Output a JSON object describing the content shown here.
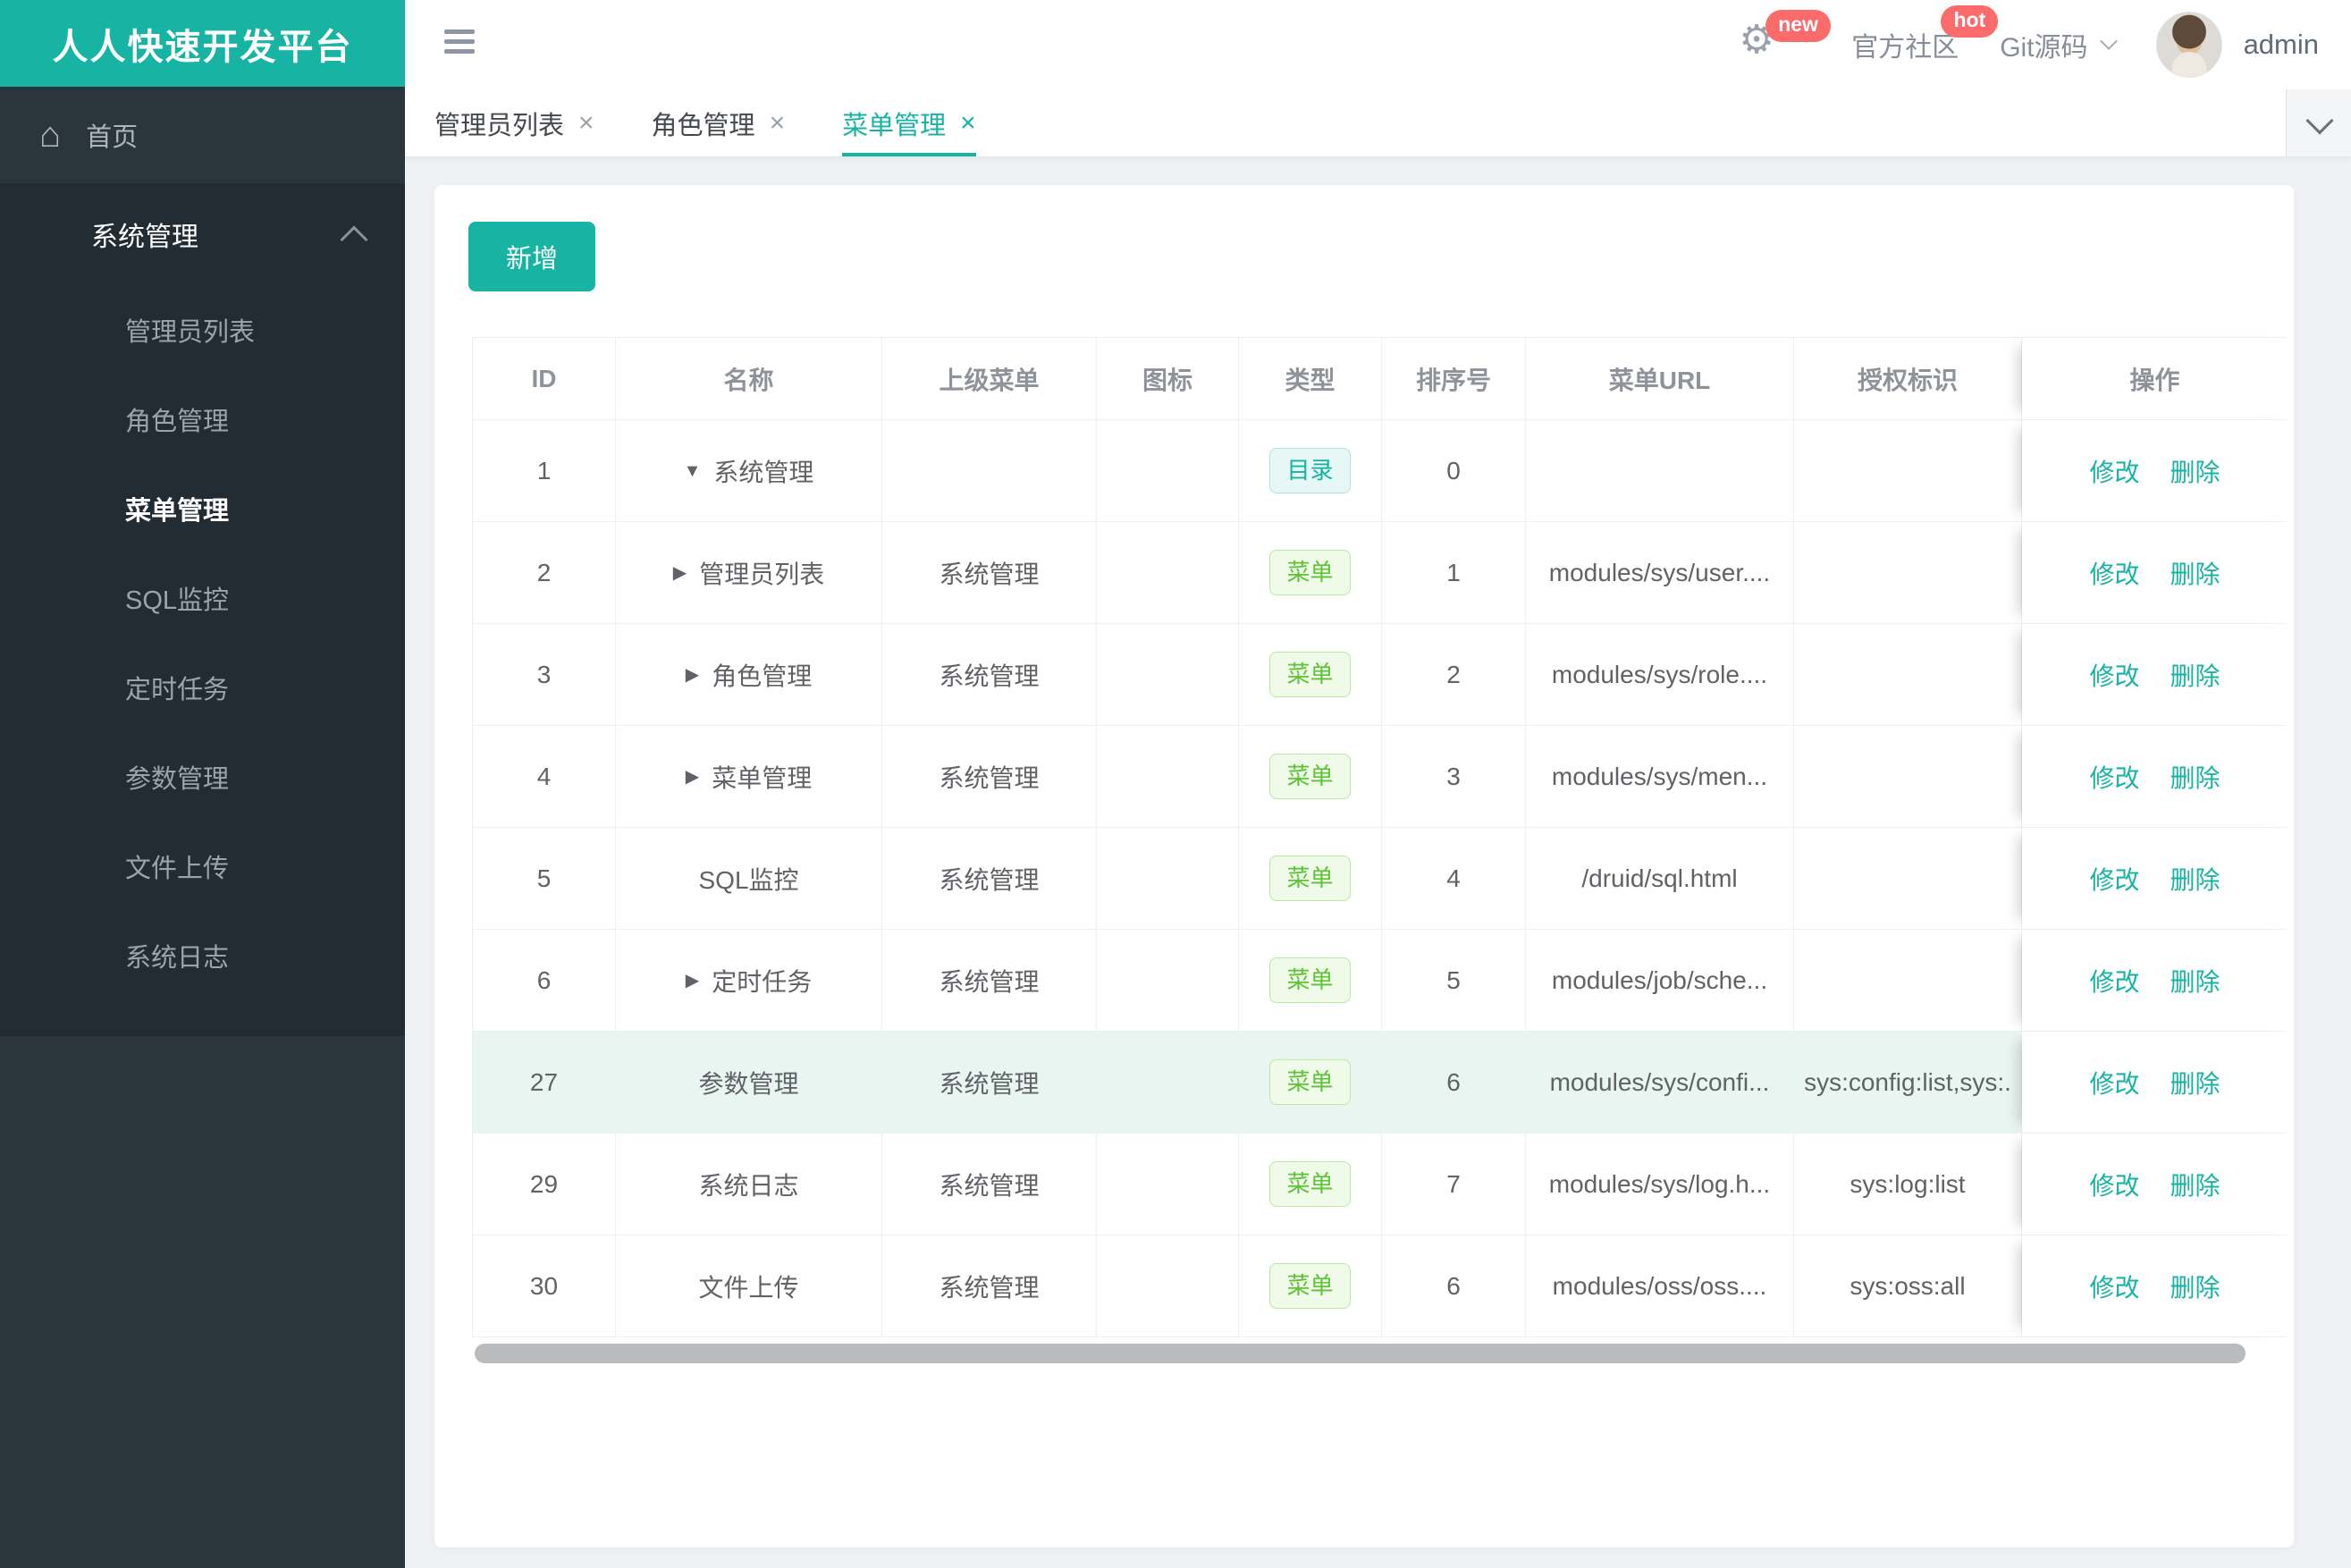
{
  "brand": {
    "title": "人人快速开发平台"
  },
  "header": {
    "gear_badge": "new",
    "community_label": "官方社区",
    "community_badge": "hot",
    "git_label": "Git源码",
    "username": "admin"
  },
  "tabbar": {
    "close_glyph": "×",
    "tabs": [
      {
        "label": "管理员列表",
        "active": false
      },
      {
        "label": "角色管理",
        "active": false
      },
      {
        "label": "菜单管理",
        "active": true
      }
    ]
  },
  "sidebar": {
    "home_label": "首页",
    "group_label": "系统管理",
    "items": [
      "管理员列表",
      "角色管理",
      "菜单管理",
      "SQL监控",
      "定时任务",
      "参数管理",
      "文件上传",
      "系统日志"
    ],
    "active_item": "菜单管理"
  },
  "toolbar": {
    "add_label": "新增"
  },
  "table": {
    "columns": [
      "ID",
      "名称",
      "上级菜单",
      "图标",
      "类型",
      "排序号",
      "菜单URL",
      "授权标识",
      "操作"
    ],
    "type_labels": {
      "dir": "目录",
      "menu": "菜单"
    },
    "action_labels": {
      "edit": "修改",
      "delete": "删除"
    },
    "arrow_glyphs": {
      "down": "▼",
      "right": "▶"
    },
    "rows": [
      {
        "id": "1",
        "arrow": "down",
        "name": "系统管理",
        "parent": "",
        "icon": "",
        "type": "dir",
        "order": "0",
        "url": "",
        "perms": "",
        "highlight": false
      },
      {
        "id": "2",
        "arrow": "right",
        "name": "管理员列表",
        "parent": "系统管理",
        "icon": "",
        "type": "menu",
        "order": "1",
        "url": "modules/sys/user....",
        "perms": "",
        "highlight": false
      },
      {
        "id": "3",
        "arrow": "right",
        "name": "角色管理",
        "parent": "系统管理",
        "icon": "",
        "type": "menu",
        "order": "2",
        "url": "modules/sys/role....",
        "perms": "",
        "highlight": false
      },
      {
        "id": "4",
        "arrow": "right",
        "name": "菜单管理",
        "parent": "系统管理",
        "icon": "",
        "type": "menu",
        "order": "3",
        "url": "modules/sys/men...",
        "perms": "",
        "highlight": false
      },
      {
        "id": "5",
        "arrow": "none",
        "name": "SQL监控",
        "parent": "系统管理",
        "icon": "",
        "type": "menu",
        "order": "4",
        "url": "/druid/sql.html",
        "perms": "",
        "highlight": false
      },
      {
        "id": "6",
        "arrow": "right",
        "name": "定时任务",
        "parent": "系统管理",
        "icon": "",
        "type": "menu",
        "order": "5",
        "url": "modules/job/sche...",
        "perms": "",
        "highlight": false
      },
      {
        "id": "27",
        "arrow": "none",
        "name": "参数管理",
        "parent": "系统管理",
        "icon": "",
        "type": "menu",
        "order": "6",
        "url": "modules/sys/confi...",
        "perms": "sys:config:list,sys:.",
        "highlight": true
      },
      {
        "id": "29",
        "arrow": "none",
        "name": "系统日志",
        "parent": "系统管理",
        "icon": "",
        "type": "menu",
        "order": "7",
        "url": "modules/sys/log.h...",
        "perms": "sys:log:list",
        "highlight": false
      },
      {
        "id": "30",
        "arrow": "none",
        "name": "文件上传",
        "parent": "系统管理",
        "icon": "",
        "type": "menu",
        "order": "6",
        "url": "modules/oss/oss....",
        "perms": "sys:oss:all",
        "highlight": false
      }
    ]
  },
  "colors": {
    "brand_teal": "#17b3a3",
    "badge_red": "#fb6b6b",
    "menu_green": "#5cc435",
    "sidebar_bg": "#2b353c",
    "sidebar_open_bg": "#232c32",
    "row_highlight": "#e9f5f1"
  }
}
